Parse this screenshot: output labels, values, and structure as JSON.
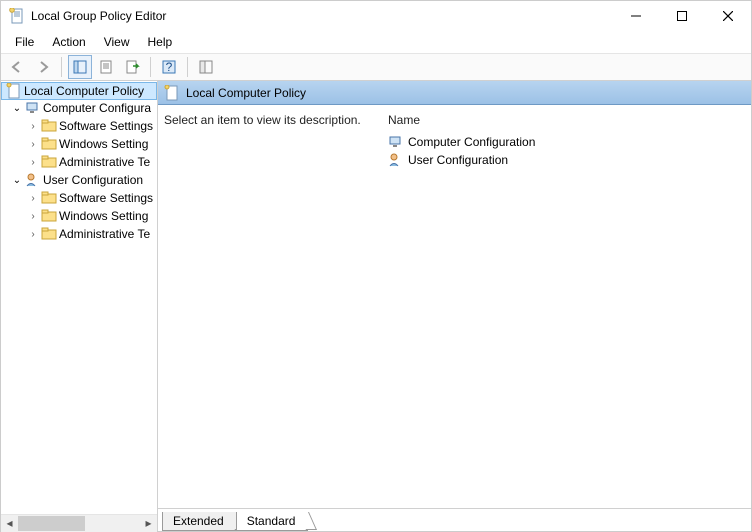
{
  "window": {
    "title": "Local Group Policy Editor"
  },
  "menu": {
    "file": "File",
    "action": "Action",
    "view": "View",
    "help": "Help"
  },
  "tree": {
    "root": "Local Computer Policy",
    "comp_config": "Computer Configura",
    "comp_sw": "Software Settings",
    "comp_win": "Windows Setting",
    "comp_admin": "Administrative Te",
    "user_config": "User Configuration",
    "user_sw": "Software Settings",
    "user_win": "Windows Setting",
    "user_admin": "Administrative Te"
  },
  "detail": {
    "header_title": "Local Computer Policy",
    "description_prompt": "Select an item to view its description.",
    "list_header": "Name",
    "items": {
      "comp": "Computer Configuration",
      "user": "User Configuration"
    }
  },
  "tabs": {
    "extended": "Extended",
    "standard": "Standard"
  }
}
